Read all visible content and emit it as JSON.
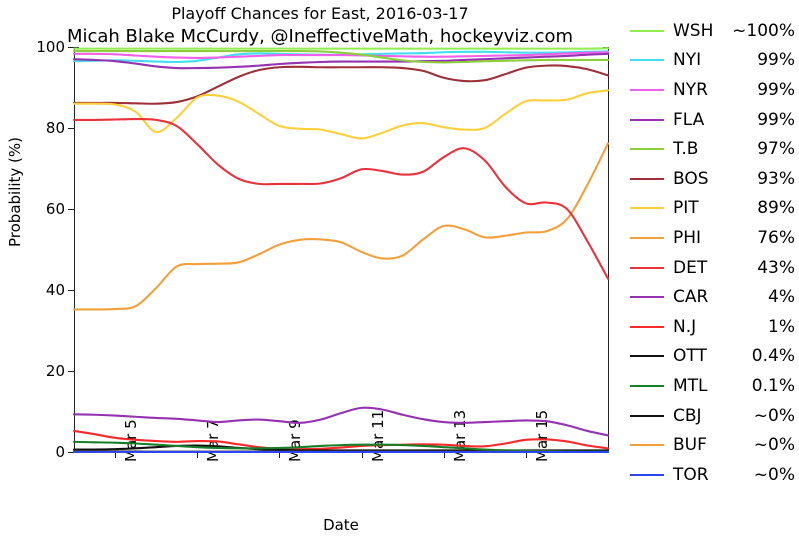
{
  "chart_data": {
    "type": "line",
    "title": "Playoff Chances for East, 2016-03-17",
    "subtitle": "Micah Blake McCurdy, @IneffectiveMath, hockeyviz.com",
    "xlabel": "Date",
    "ylabel": "Probability (%)",
    "ylim": [
      0,
      100
    ],
    "yticks": [
      0,
      20,
      40,
      60,
      80,
      100
    ],
    "ytick_labels": [
      "0",
      "20",
      "40",
      "60",
      "80",
      "100"
    ],
    "xlim": [
      "Mar 4",
      "Mar 17"
    ],
    "xtick_labels": [
      "Mar 5",
      "Mar 7",
      "Mar 9",
      "Mar 11",
      "Mar 13",
      "Mar 15"
    ],
    "xtick_days": [
      5,
      7,
      9,
      11,
      13,
      15
    ],
    "grid": false,
    "legend_position": "right",
    "x": [
      4.0,
      4.5,
      5.0,
      5.5,
      6.0,
      6.5,
      7.0,
      7.5,
      8.0,
      8.5,
      9.0,
      9.5,
      10.0,
      10.5,
      11.0,
      11.5,
      12.0,
      12.5,
      13.0,
      13.5,
      14.0,
      14.5,
      15.0,
      15.5,
      16.0,
      16.5,
      17.0
    ],
    "series": [
      {
        "name": "WSH",
        "label": "WSH",
        "value_label": "~100%",
        "color": "#90ee50",
        "values": [
          99.6,
          99.6,
          99.6,
          99.6,
          99.6,
          99.6,
          99.6,
          99.6,
          99.6,
          99.6,
          99.6,
          99.6,
          99.6,
          99.6,
          99.6,
          99.6,
          99.6,
          99.6,
          99.6,
          99.6,
          99.6,
          99.6,
          99.6,
          99.6,
          99.6,
          99.6,
          99.7
        ]
      },
      {
        "name": "NYI",
        "label": "NYI",
        "value_label": "99%",
        "color": "#40e0f0",
        "values": [
          96.5,
          96.6,
          96.7,
          96.6,
          96.4,
          96.3,
          96.6,
          97.4,
          98.2,
          98.4,
          98.3,
          98.2,
          98.1,
          98.1,
          98.2,
          98.3,
          98.4,
          98.5,
          98.7,
          98.8,
          98.8,
          98.7,
          98.6,
          98.6,
          98.7,
          98.8,
          98.9
        ]
      },
      {
        "name": "NYR",
        "label": "NYR",
        "value_label": "99%",
        "color": "#f060ea",
        "values": [
          98.3,
          98.3,
          98.2,
          97.9,
          97.6,
          97.4,
          97.3,
          97.4,
          97.6,
          97.8,
          98.0,
          98.0,
          98.0,
          98.0,
          97.9,
          97.8,
          97.7,
          97.6,
          97.6,
          97.7,
          97.8,
          97.9,
          98.0,
          98.2,
          98.4,
          98.6,
          98.7
        ]
      },
      {
        "name": "FLA",
        "label": "FLA",
        "value_label": "99%",
        "color": "#9432b0",
        "values": [
          97.0,
          96.8,
          96.5,
          95.9,
          95.2,
          94.8,
          94.8,
          94.9,
          95.1,
          95.4,
          95.8,
          96.1,
          96.3,
          96.4,
          96.4,
          96.4,
          96.4,
          96.5,
          96.6,
          96.8,
          97.0,
          97.2,
          97.4,
          97.6,
          97.8,
          98.1,
          98.3
        ]
      },
      {
        "name": "T.B",
        "label": "T.B",
        "value_label": "97%",
        "color": "#8ccf3a",
        "values": [
          99.0,
          99.0,
          99.0,
          99.0,
          99.0,
          99.0,
          99.0,
          99.0,
          99.0,
          99.0,
          99.0,
          99.0,
          98.9,
          98.6,
          98.1,
          97.4,
          96.7,
          96.3,
          96.2,
          96.3,
          96.5,
          96.6,
          96.7,
          96.8,
          96.8,
          96.8,
          96.8
        ]
      },
      {
        "name": "BOS",
        "label": "BOS",
        "value_label": "93%",
        "color": "#9d3039",
        "values": [
          86.2,
          86.2,
          86.2,
          86.1,
          86.0,
          86.4,
          87.8,
          90.2,
          92.6,
          94.3,
          95.0,
          95.1,
          95.0,
          95.0,
          95.0,
          95.0,
          94.8,
          94.1,
          92.4,
          91.6,
          91.8,
          93.3,
          94.9,
          95.4,
          95.3,
          94.5,
          93.0
        ]
      },
      {
        "name": "PIT",
        "label": "PIT",
        "value_label": "89%",
        "color": "#fdd03a",
        "values": [
          86.0,
          86.0,
          85.8,
          84.0,
          79.0,
          82.5,
          87.5,
          88.0,
          86.5,
          83.5,
          80.5,
          79.8,
          79.6,
          78.5,
          77.4,
          78.8,
          80.6,
          81.2,
          80.2,
          79.6,
          80.0,
          83.5,
          86.6,
          86.8,
          87.0,
          88.6,
          89.3
        ]
      },
      {
        "name": "PHI",
        "label": "PHI",
        "value_label": "76%",
        "color": "#f2a03a",
        "values": [
          35.2,
          35.2,
          35.3,
          36.0,
          40.5,
          45.8,
          46.4,
          46.5,
          46.8,
          48.8,
          51.2,
          52.4,
          52.5,
          51.8,
          49.4,
          47.8,
          48.5,
          52.5,
          55.8,
          55.0,
          53.0,
          53.4,
          54.2,
          54.5,
          57.5,
          66.0,
          76.2
        ]
      },
      {
        "name": "DET",
        "label": "DET",
        "value_label": "43%",
        "color": "#e8323c",
        "values": [
          82.0,
          82.0,
          82.1,
          82.2,
          82.0,
          80.5,
          76.0,
          71.0,
          67.5,
          66.2,
          66.2,
          66.2,
          66.3,
          67.6,
          69.8,
          69.4,
          68.5,
          69.2,
          72.8,
          75.0,
          72.0,
          65.5,
          61.4,
          61.6,
          60.0,
          52.0,
          42.8
        ]
      },
      {
        "name": "CAR",
        "label": "CAR",
        "value_label": "4%",
        "color": "#9432b0",
        "values": [
          9.3,
          9.2,
          9.0,
          8.7,
          8.4,
          8.2,
          7.8,
          7.4,
          7.8,
          8.0,
          7.6,
          7.2,
          8.0,
          9.6,
          10.9,
          10.5,
          9.2,
          8.1,
          7.4,
          7.2,
          7.4,
          7.6,
          7.8,
          7.6,
          6.6,
          5.2,
          4.1
        ]
      },
      {
        "name": "N.J",
        "label": "N.J",
        "value_label": "1%",
        "color": "#fa2a2a",
        "values": [
          5.2,
          4.4,
          3.5,
          3.0,
          2.7,
          2.5,
          2.7,
          2.6,
          1.9,
          1.2,
          0.8,
          0.7,
          0.8,
          1.1,
          1.5,
          1.7,
          1.8,
          1.9,
          1.8,
          1.5,
          1.4,
          2.1,
          3.0,
          3.1,
          2.6,
          1.6,
          0.9
        ]
      },
      {
        "name": "OTT",
        "label": "OTT",
        "value_label": "0.4%",
        "color": "#111111",
        "values": [
          0.6,
          0.6,
          0.7,
          0.9,
          1.2,
          1.5,
          1.6,
          1.4,
          1.0,
          0.7,
          0.5,
          0.4,
          0.4,
          0.4,
          0.4,
          0.4,
          0.4,
          0.4,
          0.4,
          0.4,
          0.4,
          0.4,
          0.4,
          0.4,
          0.4,
          0.4,
          0.4
        ]
      },
      {
        "name": "MTL",
        "label": "MTL",
        "value_label": "0.1%",
        "color": "#157f2a",
        "values": [
          2.5,
          2.4,
          2.3,
          2.1,
          1.8,
          1.5,
          1.2,
          1.0,
          0.9,
          0.9,
          1.0,
          1.2,
          1.5,
          1.7,
          1.8,
          1.8,
          1.7,
          1.5,
          1.2,
          0.9,
          0.6,
          0.4,
          0.3,
          0.2,
          0.15,
          0.12,
          0.1
        ]
      },
      {
        "name": "CBJ",
        "label": "CBJ",
        "value_label": "~0%",
        "color": "#111111",
        "values": [
          0.15,
          0.15,
          0.14,
          0.13,
          0.12,
          0.12,
          0.11,
          0.1,
          0.1,
          0.1,
          0.09,
          0.09,
          0.08,
          0.08,
          0.07,
          0.07,
          0.06,
          0.06,
          0.05,
          0.05,
          0.04,
          0.04,
          0.03,
          0.03,
          0.02,
          0.02,
          0.02
        ]
      },
      {
        "name": "BUF",
        "label": "BUF",
        "value_label": "~0%",
        "color": "#f2a03a",
        "values": [
          0.06,
          0.06,
          0.05,
          0.05,
          0.05,
          0.04,
          0.04,
          0.04,
          0.03,
          0.03,
          0.03,
          0.03,
          0.02,
          0.02,
          0.02,
          0.02,
          0.02,
          0.01,
          0.01,
          0.01,
          0.01,
          0.01,
          0.01,
          0.01,
          0.0,
          0.0,
          0.0
        ]
      },
      {
        "name": "TOR",
        "label": "TOR",
        "value_label": "~0%",
        "color": "#2a46f0",
        "values": [
          0.03,
          0.03,
          0.03,
          0.02,
          0.02,
          0.02,
          0.02,
          0.02,
          0.02,
          0.01,
          0.01,
          0.01,
          0.01,
          0.01,
          0.01,
          0.01,
          0.01,
          0.0,
          0.0,
          0.0,
          0.0,
          0.0,
          0.0,
          0.0,
          0.0,
          0.0,
          0.0
        ]
      }
    ]
  }
}
